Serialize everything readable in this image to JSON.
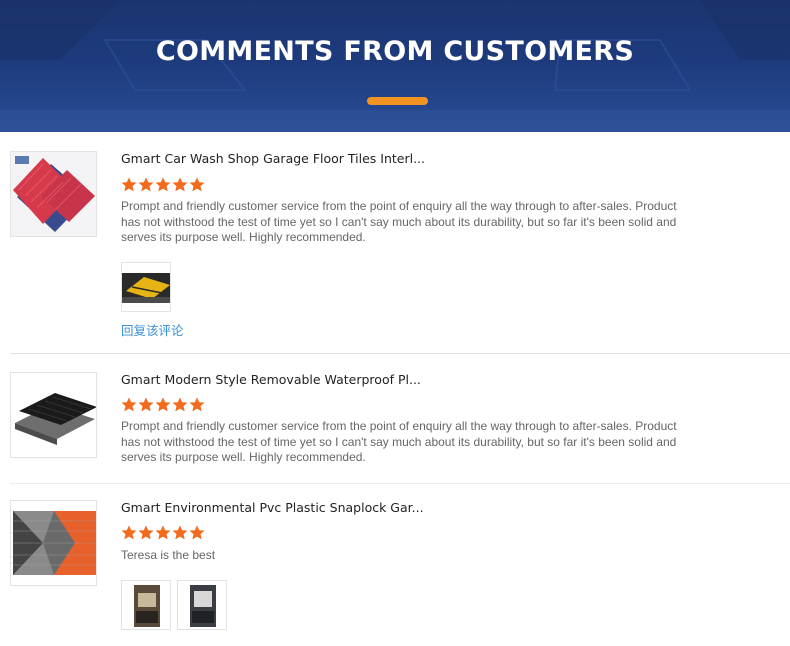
{
  "header": {
    "title": "COMMENTS FROM CUSTOMERS"
  },
  "colors": {
    "banner": "#1d3a7c",
    "accent_bar": "#f39322",
    "star": "#f26b1d",
    "link": "#3a8fd6"
  },
  "reviews": [
    {
      "title": "Gmart Car Wash Shop Garage Floor Tiles Interl...",
      "rating": 5,
      "text": "Prompt and friendly customer service from the point of enquiry all the way through to after-sales. Product has not withstood the test of time yet so I can't say much about its durability, but so far it's been solid and serves its purpose well. Highly recommended.",
      "product_image": "red-blue-interlocking-tiles",
      "photos": [
        "yellow-tile-garage-photo"
      ],
      "reply_label": "回复该评论"
    },
    {
      "title": "Gmart Modern Style Removable Waterproof Pl...",
      "rating": 5,
      "text": "Prompt and friendly customer service from the point of enquiry all the way through to after-sales. Product has not withstood the test of time yet so I can't say much about its durability, but so far it's been solid and serves its purpose well. Highly recommended.",
      "product_image": "black-grey-floor-tiles",
      "photos": []
    },
    {
      "title": "Gmart Environmental Pvc Plastic Snaplock Gar...",
      "rating": 5,
      "text": "Teresa is the best",
      "product_image": "grey-orange-snaplock-tiles",
      "photos": [
        "package-photo-1",
        "package-photo-2"
      ]
    }
  ]
}
